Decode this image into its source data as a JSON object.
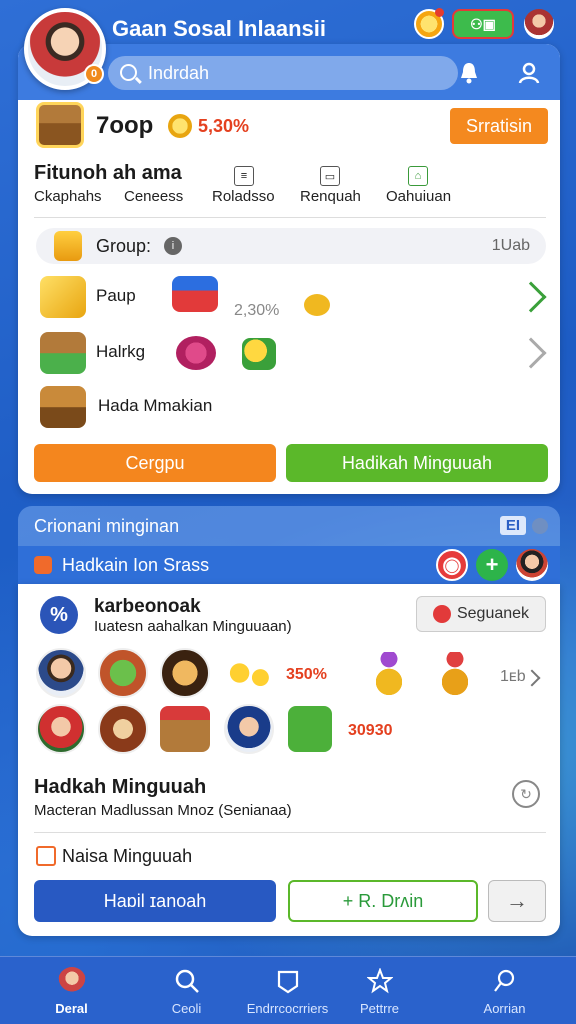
{
  "header": {
    "title": "Gaan Sosal Inlaansii",
    "avatar_badge": "0",
    "chat_badge": "⚇▣"
  },
  "search": {
    "placeholder": "Indrdah"
  },
  "stats": {
    "value": "7oop",
    "percent": "5,30%",
    "start_label": "Srratisin"
  },
  "features": {
    "title": "Fitunoh ah ama",
    "tabs": [
      {
        "label": "Ckaphahs",
        "icon": "none"
      },
      {
        "label": "Ceneess",
        "icon": "none"
      },
      {
        "label": "Roladsso",
        "icon": "list-icon"
      },
      {
        "label": "Renquah",
        "icon": "chat-icon"
      },
      {
        "label": "Oahuiuan",
        "icon": "bag-icon"
      }
    ]
  },
  "group": {
    "label": "Group:",
    "count": "1Uab"
  },
  "games": [
    {
      "name": "Paup",
      "pct": "2,30%"
    },
    {
      "name": "Halrkg",
      "pct": ""
    },
    {
      "name": "Hada Mmakian",
      "pct": ""
    }
  ],
  "actions": {
    "orange_label": "Cergpu",
    "green_label": "Hadikah Minguuah"
  },
  "section2": {
    "title": "Crionani minginan",
    "badge": "EI",
    "sub_title": "Hadkain Ion Srass"
  },
  "promo": {
    "title": "karbeonoak",
    "subtitle": "Iuatesn aahalkan Minguuaan)",
    "watch_label": "Seguanek"
  },
  "grid": {
    "row1_pct": "350%",
    "row1_count": "1ᴇb",
    "row2_value": "30930"
  },
  "hadkah": {
    "title": "Hadkah Minguuah",
    "subtitle": "Macteran Madlussan Mnoz (Senianaa)"
  },
  "naisa": {
    "title": "Naisa Minguuah"
  },
  "bottom_buttons": {
    "blue_label": "Haɒil ɪanoah",
    "outline_label": "+ R. Drʌin",
    "arrow_label": "→"
  },
  "nav": [
    {
      "label": "Deral",
      "icon": "home-avatar-icon"
    },
    {
      "label": "Ceoli",
      "icon": "search-icon"
    },
    {
      "label": "Endrrcocrriers",
      "icon": "badge-icon"
    },
    {
      "label": "Pettrre",
      "icon": "star-icon"
    },
    {
      "label": "Aorrian",
      "icon": "pin-icon"
    }
  ],
  "colors": {
    "primary": "#2f6fd6",
    "orange": "#f4861e",
    "green": "#5bb82a",
    "red": "#e4401f"
  }
}
